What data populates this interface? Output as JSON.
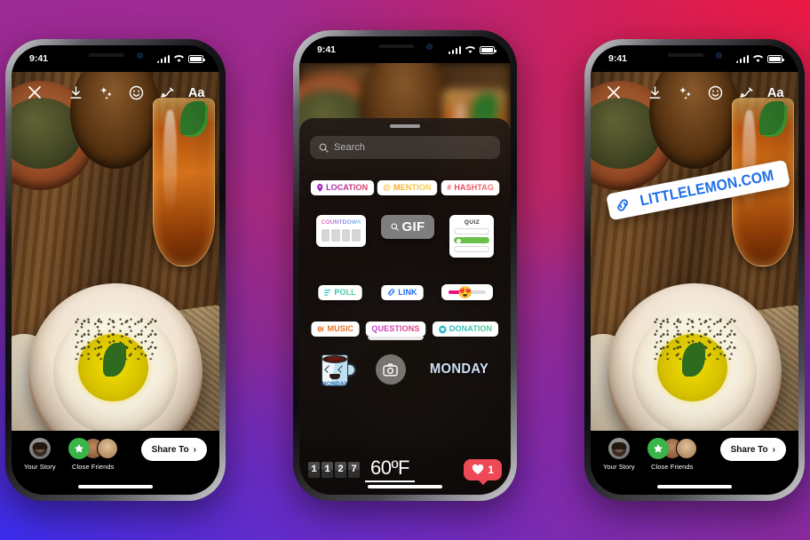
{
  "status_bar": {
    "time": "9:41",
    "signal_icon": "cellular-bars-icon",
    "wifi_icon": "wifi-icon",
    "battery_icon": "battery-icon"
  },
  "toolbar": {
    "close_label": "close-icon",
    "items": [
      {
        "name": "save-icon",
        "label": "Save"
      },
      {
        "name": "effects-icon",
        "label": "Effects"
      },
      {
        "name": "sticker-icon",
        "label": "Stickers"
      },
      {
        "name": "draw-icon",
        "label": "Draw"
      },
      {
        "name": "text-icon",
        "label": "Aa"
      }
    ]
  },
  "share_bar": {
    "your_story_label": "Your Story",
    "close_friends_label": "Close Friends",
    "share_to_label": "Share To",
    "chevron": "›"
  },
  "link_sticker": {
    "text": "LITTLELEMON.COM",
    "icon": "link-chain-icon"
  },
  "tray": {
    "search_placeholder": "Search",
    "search_icon": "search-icon",
    "row1": [
      {
        "id": "location",
        "label": "LOCATION",
        "icon": "pin-icon"
      },
      {
        "id": "mention",
        "label": "MENTION",
        "icon": "at-sign-icon"
      },
      {
        "id": "hashtag",
        "label": "HASHTAG",
        "icon": "hash-icon"
      }
    ],
    "countdown": {
      "label": "COUNTDOWN",
      "digit_boxes": 4
    },
    "gif": {
      "label": "GIF",
      "icon": "search-icon"
    },
    "quiz": {
      "label": "QUIZ",
      "options": 3,
      "selected_index": 1
    },
    "row3": [
      {
        "id": "poll",
        "label": "POLL",
        "icon": "poll-bars-icon"
      },
      {
        "id": "link",
        "label": "LINK",
        "icon": "link-chain-icon"
      }
    ],
    "emoji_slider": {
      "emoji": "😍",
      "fill_percent": 52
    },
    "row4": [
      {
        "id": "music",
        "label": "MUSIC",
        "icon": "music-bars-icon"
      },
      {
        "id": "questions",
        "label": "QUESTIONS",
        "icon": ""
      },
      {
        "id": "donation",
        "label": "DONATION",
        "icon": "heart-hand-icon"
      }
    ],
    "mug_sticker": {
      "label": "MONDAY"
    },
    "camera_button": {
      "icon": "camera-icon"
    },
    "monday_text": "MONDAY",
    "clock": {
      "digits": [
        "1",
        "1",
        "2",
        "7"
      ]
    },
    "temperature": "60ºF",
    "like_badge": {
      "count": "1",
      "icon": "heart-icon"
    }
  },
  "colors": {
    "accent_blue": "#1e6fe8",
    "like_red": "#ed4956",
    "close_friends_green": "#39b54a",
    "quiz_green": "#6bbf4a",
    "slider_pink": "#e8117f",
    "music_orange": "#e8722a"
  }
}
